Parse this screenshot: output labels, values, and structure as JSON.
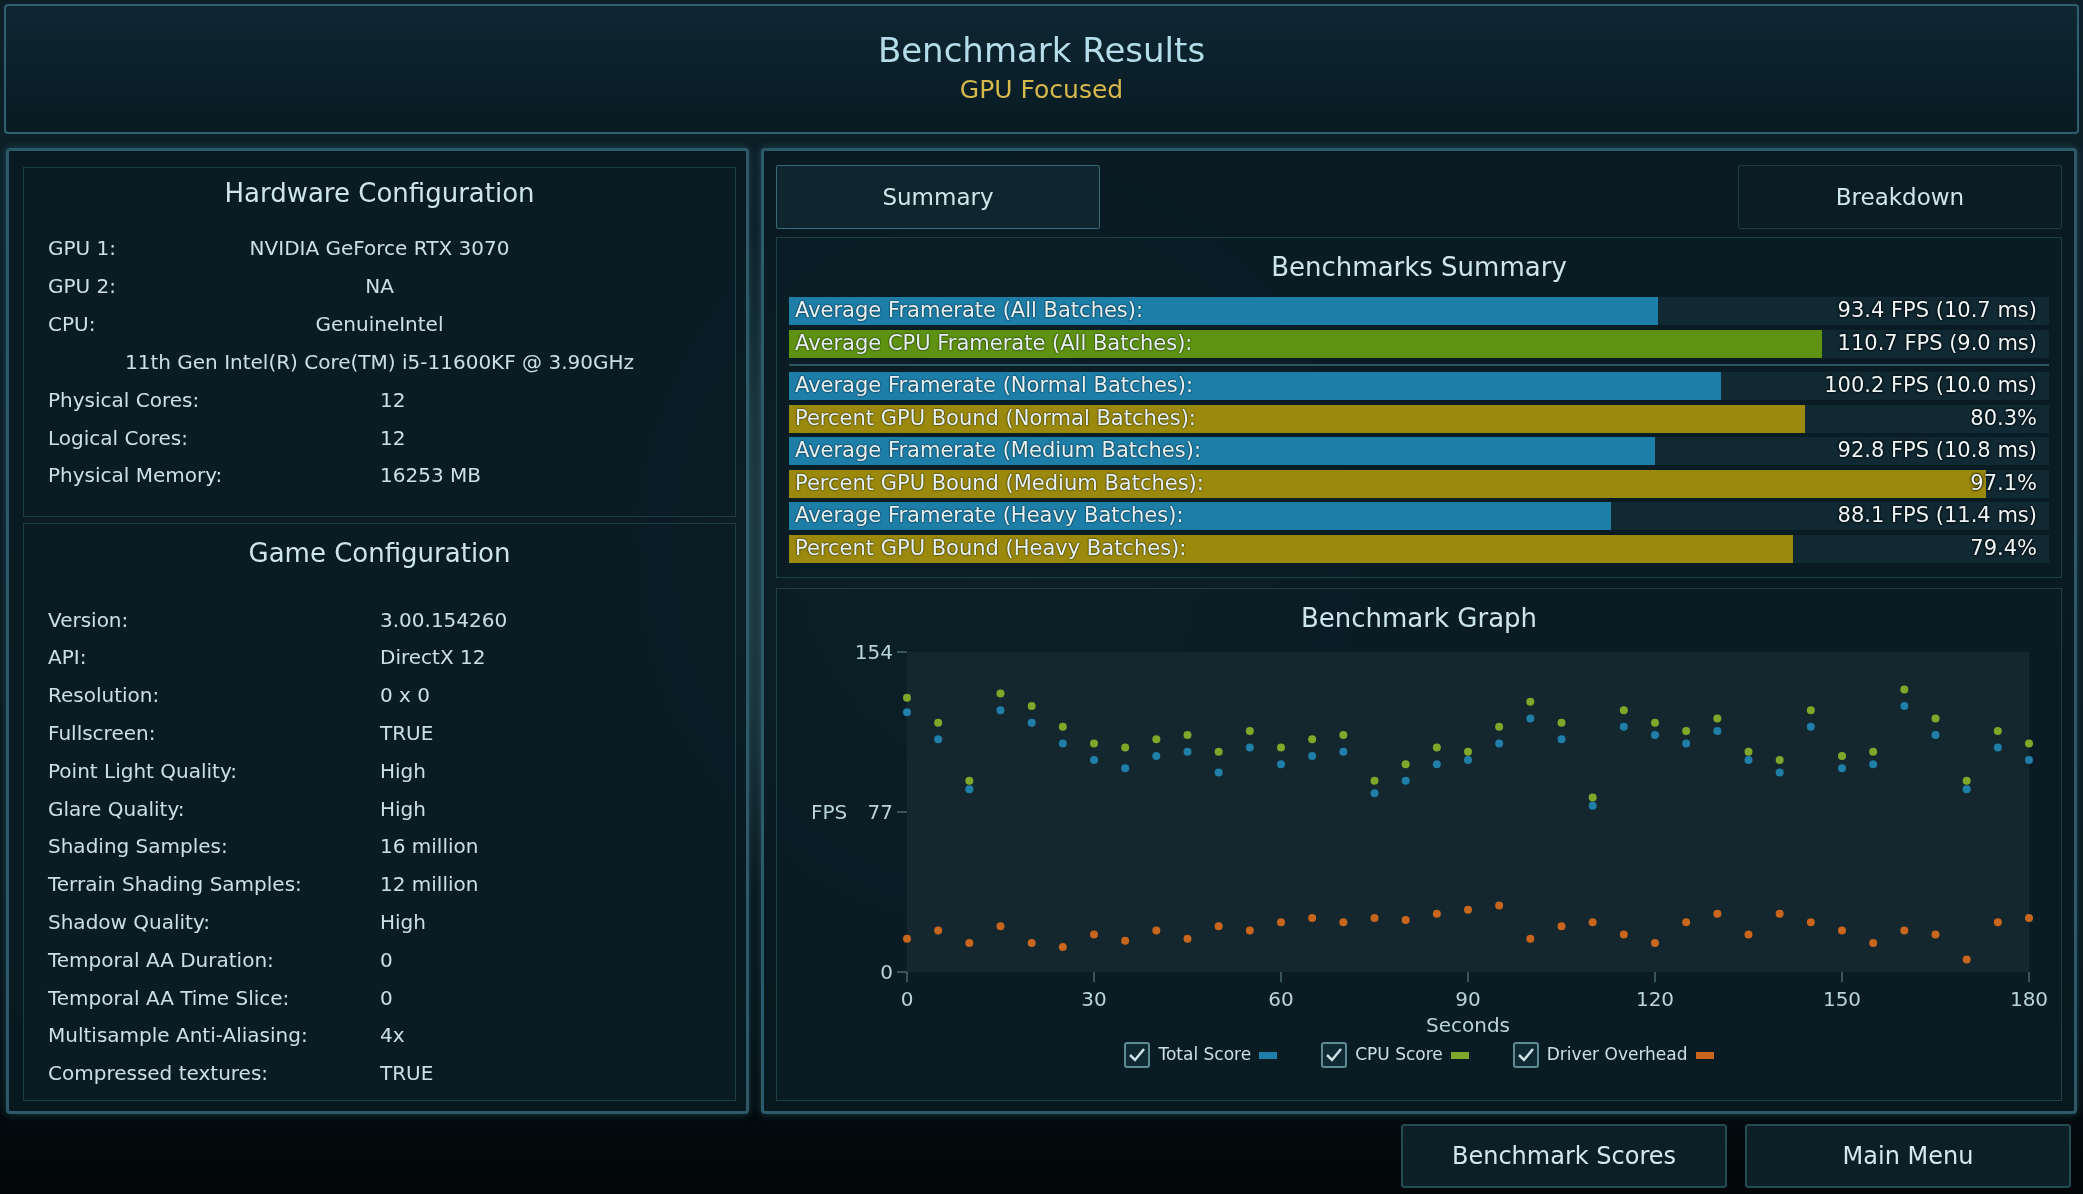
{
  "header": {
    "title": "Benchmark Results",
    "subtitle": "GPU Focused"
  },
  "hardware": {
    "title": "Hardware Configuration",
    "rows": [
      {
        "kind": "centered",
        "label": "GPU 1:",
        "value": "NVIDIA GeForce RTX 3070"
      },
      {
        "kind": "centered",
        "label": "GPU 2:",
        "value": "NA"
      },
      {
        "kind": "centered",
        "label": "CPU:",
        "value": "GenuineIntel"
      },
      {
        "kind": "note",
        "value": "11th Gen Intel(R) Core(TM) i5-11600KF @ 3.90GHz"
      },
      {
        "kind": "aligned",
        "label": "Physical Cores:",
        "value": "12"
      },
      {
        "kind": "aligned",
        "label": "Logical Cores:",
        "value": "12"
      },
      {
        "kind": "aligned",
        "label": "Physical Memory:",
        "value": "16253  MB"
      }
    ]
  },
  "game": {
    "title": "Game Configuration",
    "rows": [
      {
        "label": "Version:",
        "value": "3.00.154260"
      },
      {
        "label": "API:",
        "value": "DirectX 12"
      },
      {
        "label": "Resolution:",
        "value": "0 x 0"
      },
      {
        "label": "Fullscreen:",
        "value": "TRUE"
      },
      {
        "label": "Point Light Quality:",
        "value": "High"
      },
      {
        "label": "Glare Quality:",
        "value": "High"
      },
      {
        "label": "Shading Samples:",
        "value": "16 million"
      },
      {
        "label": "Terrain Shading Samples:",
        "value": "12 million"
      },
      {
        "label": "Shadow Quality:",
        "value": "High"
      },
      {
        "label": "Temporal AA Duration:",
        "value": "0"
      },
      {
        "label": "Temporal AA Time Slice:",
        "value": "0"
      },
      {
        "label": "Multisample Anti-Aliasing:",
        "value": "4x"
      },
      {
        "label": "Compressed textures:",
        "value": "TRUE"
      }
    ]
  },
  "tabs": [
    {
      "label": "Summary",
      "selected": true
    },
    {
      "label": "Breakdown",
      "selected": false
    }
  ],
  "summary": {
    "title": "Benchmarks Summary",
    "groups": [
      {
        "rows": [
          {
            "kind": "fps",
            "label": "Average Framerate (All Batches):",
            "level": 0.69,
            "value": "93.4 FPS (10.7 ms)"
          },
          {
            "kind": "cpu",
            "label": "Average CPU Framerate (All Batches):",
            "level": 0.82,
            "value": "110.7 FPS (9.0 ms)"
          }
        ]
      },
      {
        "rows": [
          {
            "kind": "fps",
            "label": "Average Framerate (Normal Batches):",
            "level": 0.74,
            "value": "100.2 FPS (10.0 ms)"
          },
          {
            "kind": "gpu",
            "label": "Percent GPU Bound (Normal Batches):",
            "level": 0.806,
            "value": "80.3%"
          },
          {
            "kind": "fps",
            "label": "Average Framerate (Medium Batches):",
            "level": 0.687,
            "value": "92.8 FPS (10.8 ms)"
          },
          {
            "kind": "gpu",
            "label": "Percent GPU Bound (Medium Batches):",
            "level": 0.95,
            "value": "97.1%"
          },
          {
            "kind": "fps",
            "label": "Average Framerate (Heavy Batches):",
            "level": 0.652,
            "value": "88.1 FPS (11.4 ms)"
          },
          {
            "kind": "gpu",
            "label": "Percent GPU Bound (Heavy Batches):",
            "level": 0.797,
            "value": "79.4%"
          }
        ]
      }
    ]
  },
  "graph": {
    "title": "Benchmark Graph",
    "legend": [
      {
        "checked": true
      },
      {
        "checked": true
      },
      {
        "checked": true
      }
    ],
    "chart_data": {
      "type": "scatter",
      "xlabel": "Seconds",
      "ylabel": "FPS",
      "x": [
        0,
        5,
        10,
        15,
        20,
        25,
        30,
        35,
        40,
        45,
        50,
        55,
        60,
        65,
        70,
        75,
        80,
        85,
        90,
        95,
        100,
        105,
        110,
        115,
        120,
        125,
        130,
        135,
        140,
        145,
        150,
        155,
        160,
        165,
        170,
        175,
        180
      ],
      "series": [
        {
          "name": "Total Score",
          "color": "#1f7fa8",
          "values": [
            125,
            112,
            88,
            126,
            120,
            110,
            102,
            98,
            104,
            106,
            96,
            108,
            100,
            104,
            106,
            86,
            92,
            100,
            102,
            110,
            122,
            112,
            80,
            118,
            114,
            110,
            116,
            102,
            96,
            118,
            98,
            100,
            128,
            114,
            88,
            108,
            102
          ]
        },
        {
          "name": "CPU Score",
          "color": "#7fa82a",
          "values": [
            132,
            120,
            92,
            134,
            128,
            118,
            110,
            108,
            112,
            114,
            106,
            116,
            108,
            112,
            114,
            92,
            100,
            108,
            106,
            118,
            130,
            120,
            84,
            126,
            120,
            116,
            122,
            106,
            102,
            126,
            104,
            106,
            136,
            122,
            92,
            116,
            110
          ]
        },
        {
          "name": "Driver Overhead",
          "color": "#c8661e",
          "values": [
            16,
            20,
            14,
            22,
            14,
            12,
            18,
            15,
            20,
            16,
            22,
            20,
            24,
            26,
            24,
            26,
            25,
            28,
            30,
            32,
            16,
            22,
            24,
            18,
            14,
            24,
            28,
            18,
            28,
            24,
            20,
            14,
            20,
            18,
            6,
            24,
            26
          ]
        }
      ],
      "xlim": [
        0,
        180
      ],
      "ylim": [
        0,
        154
      ],
      "xticks": [
        0,
        30,
        60,
        90,
        120,
        150,
        180
      ],
      "yticks": [
        0,
        77,
        154
      ]
    }
  },
  "buttons": [
    {
      "label": "Benchmark Scores"
    },
    {
      "label": "Main Menu"
    }
  ]
}
